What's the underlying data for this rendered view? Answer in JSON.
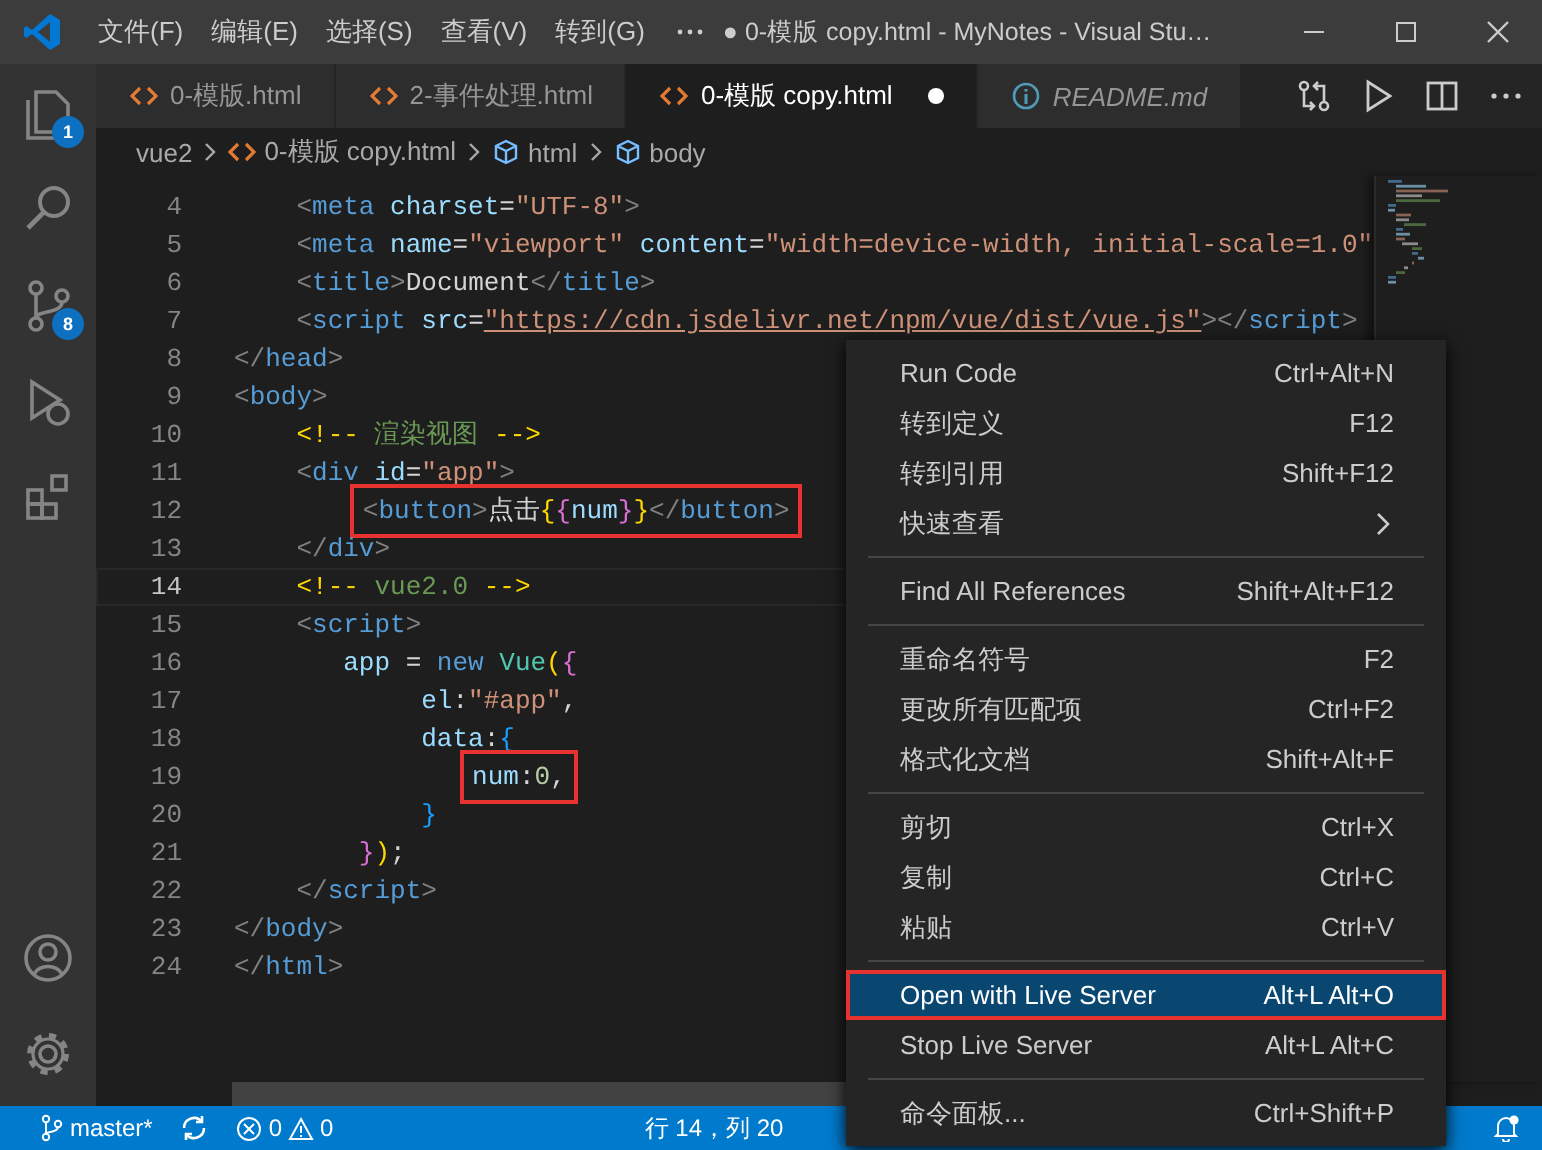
{
  "window": {
    "title": "● 0-模版 copy.html - MyNotes - Visual Stu…"
  },
  "menu_bar": [
    "文件(F)",
    "编辑(E)",
    "选择(S)",
    "查看(V)",
    "转到(G)"
  ],
  "activity_bar": {
    "top": [
      {
        "kind": "files",
        "badge": "1"
      },
      {
        "kind": "search"
      },
      {
        "kind": "scm",
        "badge": "8"
      },
      {
        "kind": "debug"
      },
      {
        "kind": "extensions"
      }
    ],
    "bottom": [
      {
        "kind": "account"
      },
      {
        "kind": "settings"
      }
    ]
  },
  "tabs": [
    {
      "label": "0-模版.html",
      "kind": "html",
      "selected": false,
      "modified": false,
      "preview": false
    },
    {
      "label": "2-事件处理.html",
      "kind": "html",
      "selected": false,
      "modified": false,
      "preview": false
    },
    {
      "label": "0-模版 copy.html",
      "kind": "html",
      "selected": true,
      "modified": true,
      "preview": false
    },
    {
      "label": "README.md",
      "kind": "info",
      "selected": false,
      "modified": false,
      "preview": true
    }
  ],
  "breadcrumb": [
    {
      "label": "vue2",
      "kind": "folder"
    },
    {
      "label": "0-模版 copy.html",
      "kind": "html"
    },
    {
      "label": "html",
      "kind": "element"
    },
    {
      "label": "body",
      "kind": "element"
    }
  ],
  "editor": {
    "lines": [
      {
        "number": "4",
        "tokens": [
          {
            "text": "    <",
            "kind": "p"
          },
          {
            "text": "meta",
            "kind": "tag"
          },
          {
            "text": " charset",
            "kind": "attr"
          },
          {
            "text": "=",
            "kind": "txt"
          },
          {
            "text": "\"UTF-8\"",
            "kind": "str"
          },
          {
            "text": ">",
            "kind": "p"
          }
        ]
      },
      {
        "number": "5",
        "tokens": [
          {
            "text": "    <",
            "kind": "p"
          },
          {
            "text": "meta",
            "kind": "tag"
          },
          {
            "text": " name",
            "kind": "attr"
          },
          {
            "text": "=",
            "kind": "txt"
          },
          {
            "text": "\"viewport\"",
            "kind": "str"
          },
          {
            "text": " content",
            "kind": "attr"
          },
          {
            "text": "=",
            "kind": "txt"
          },
          {
            "text": "\"width=device-width, initial-scale=1.0\"",
            "kind": "str"
          }
        ]
      },
      {
        "number": "6",
        "tokens": [
          {
            "text": "    <",
            "kind": "p"
          },
          {
            "text": "title",
            "kind": "tag"
          },
          {
            "text": ">",
            "kind": "p"
          },
          {
            "text": "Document",
            "kind": "txt"
          },
          {
            "text": "</",
            "kind": "p"
          },
          {
            "text": "title",
            "kind": "tag"
          },
          {
            "text": ">",
            "kind": "p"
          }
        ]
      },
      {
        "number": "7",
        "tokens": [
          {
            "text": "    <",
            "kind": "p"
          },
          {
            "text": "script",
            "kind": "tag"
          },
          {
            "text": " src",
            "kind": "attr"
          },
          {
            "text": "=",
            "kind": "txt"
          },
          {
            "text": "\"https://cdn.jsdelivr.net/npm/vue/dist/vue.js\"",
            "kind": "link"
          },
          {
            "text": ">",
            "kind": "p"
          },
          {
            "text": "</",
            "kind": "p"
          },
          {
            "text": "script",
            "kind": "tag"
          },
          {
            "text": ">",
            "kind": "p"
          }
        ]
      },
      {
        "number": "8",
        "tokens": [
          {
            "text": "</",
            "kind": "p"
          },
          {
            "text": "head",
            "kind": "tag"
          },
          {
            "text": ">",
            "kind": "p"
          }
        ]
      },
      {
        "number": "9",
        "tokens": [
          {
            "text": "<",
            "kind": "p"
          },
          {
            "text": "body",
            "kind": "tag"
          },
          {
            "text": ">",
            "kind": "p"
          }
        ]
      },
      {
        "number": "10",
        "tokens": [
          {
            "text": "    <!--",
            "kind": "y"
          },
          {
            "text": " 渲染视图 ",
            "kind": "cmt"
          },
          {
            "text": "-->",
            "kind": "y"
          }
        ]
      },
      {
        "number": "11",
        "tokens": [
          {
            "text": "    <",
            "kind": "p"
          },
          {
            "text": "div",
            "kind": "tag"
          },
          {
            "text": " id",
            "kind": "attr"
          },
          {
            "text": "=",
            "kind": "txt"
          },
          {
            "text": "\"app\"",
            "kind": "str"
          },
          {
            "text": ">",
            "kind": "p"
          }
        ]
      },
      {
        "number": "12",
        "annotated": true,
        "tokens": [
          {
            "text": "        <",
            "kind": "p"
          },
          {
            "text": "button",
            "kind": "tag"
          },
          {
            "text": ">",
            "kind": "p"
          },
          {
            "text": "点击",
            "kind": "txt"
          },
          {
            "text": "{",
            "kind": "y"
          },
          {
            "text": "{",
            "kind": "m"
          },
          {
            "text": "num",
            "kind": "var"
          },
          {
            "text": "}",
            "kind": "m"
          },
          {
            "text": "}",
            "kind": "y"
          },
          {
            "text": "</",
            "kind": "p"
          },
          {
            "text": "button",
            "kind": "tag"
          },
          {
            "text": ">",
            "kind": "p"
          }
        ]
      },
      {
        "number": "13",
        "tokens": [
          {
            "text": "    </",
            "kind": "p"
          },
          {
            "text": "div",
            "kind": "tag"
          },
          {
            "text": ">",
            "kind": "p"
          }
        ]
      },
      {
        "number": "14",
        "current": true,
        "tokens": [
          {
            "text": "    <!--",
            "kind": "y"
          },
          {
            "text": " vue2.0 ",
            "kind": "cmt"
          },
          {
            "text": "-->",
            "kind": "y"
          }
        ]
      },
      {
        "number": "15",
        "tokens": [
          {
            "text": "    <",
            "kind": "p"
          },
          {
            "text": "script",
            "kind": "tag"
          },
          {
            "text": ">",
            "kind": "p"
          }
        ]
      },
      {
        "number": "16",
        "tokens": [
          {
            "text": "       app",
            "kind": "var"
          },
          {
            "text": " = ",
            "kind": "txt"
          },
          {
            "text": "new ",
            "kind": "kw"
          },
          {
            "text": "Vue",
            "kind": "cls"
          },
          {
            "text": "(",
            "kind": "y"
          },
          {
            "text": "{",
            "kind": "m"
          }
        ]
      },
      {
        "number": "17",
        "tokens": [
          {
            "text": "            el",
            "kind": "var"
          },
          {
            "text": ":",
            "kind": "txt"
          },
          {
            "text": "\"#app\"",
            "kind": "str"
          },
          {
            "text": ",",
            "kind": "txt"
          }
        ]
      },
      {
        "number": "18",
        "tokens": [
          {
            "text": "            data",
            "kind": "var"
          },
          {
            "text": ":",
            "kind": "txt"
          },
          {
            "text": "{",
            "kind": "b"
          }
        ]
      },
      {
        "number": "19",
        "annotated": true,
        "tokens": [
          {
            "text": "               num",
            "kind": "var"
          },
          {
            "text": ":",
            "kind": "txt"
          },
          {
            "text": "0",
            "kind": "num"
          },
          {
            "text": ",",
            "kind": "txt"
          }
        ]
      },
      {
        "number": "20",
        "tokens": [
          {
            "text": "            }",
            "kind": "b"
          }
        ]
      },
      {
        "number": "21",
        "tokens": [
          {
            "text": "        }",
            "kind": "m"
          },
          {
            "text": ")",
            "kind": "y"
          },
          {
            "text": ";",
            "kind": "txt"
          }
        ]
      },
      {
        "number": "22",
        "tokens": [
          {
            "text": "    </",
            "kind": "p"
          },
          {
            "text": "script",
            "kind": "tag"
          },
          {
            "text": ">",
            "kind": "p"
          }
        ]
      },
      {
        "number": "23",
        "tokens": [
          {
            "text": "</",
            "kind": "p"
          },
          {
            "text": "body",
            "kind": "tag"
          },
          {
            "text": ">",
            "kind": "p"
          }
        ]
      },
      {
        "number": "24",
        "tokens": [
          {
            "text": "</",
            "kind": "p"
          },
          {
            "text": "html",
            "kind": "tag"
          },
          {
            "text": ">",
            "kind": "p"
          }
        ]
      }
    ]
  },
  "context_menu": {
    "groups": [
      [
        {
          "label": "Run Code",
          "shortcut": "Ctrl+Alt+N",
          "submenu": false,
          "selected": false,
          "annotated": false
        },
        {
          "label": "转到定义",
          "shortcut": "F12",
          "submenu": false,
          "selected": false,
          "annotated": false
        },
        {
          "label": "转到引用",
          "shortcut": "Shift+F12",
          "submenu": false,
          "selected": false,
          "annotated": false
        },
        {
          "label": "快速查看",
          "submenu": true,
          "selected": false,
          "annotated": false
        }
      ],
      [
        {
          "label": "Find All References",
          "shortcut": "Shift+Alt+F12",
          "submenu": false,
          "selected": false,
          "annotated": false
        }
      ],
      [
        {
          "label": "重命名符号",
          "shortcut": "F2",
          "submenu": false,
          "selected": false,
          "annotated": false
        },
        {
          "label": "更改所有匹配项",
          "shortcut": "Ctrl+F2",
          "submenu": false,
          "selected": false,
          "annotated": false
        },
        {
          "label": "格式化文档",
          "shortcut": "Shift+Alt+F",
          "submenu": false,
          "selected": false,
          "annotated": false
        }
      ],
      [
        {
          "label": "剪切",
          "shortcut": "Ctrl+X",
          "submenu": false,
          "selected": false,
          "annotated": false
        },
        {
          "label": "复制",
          "shortcut": "Ctrl+C",
          "submenu": false,
          "selected": false,
          "annotated": false
        },
        {
          "label": "粘贴",
          "shortcut": "Ctrl+V",
          "submenu": false,
          "selected": false,
          "annotated": false
        }
      ],
      [
        {
          "label": "Open with Live Server",
          "shortcut": "Alt+L Alt+O",
          "submenu": false,
          "selected": true,
          "annotated": true
        },
        {
          "label": "Stop Live Server",
          "shortcut": "Alt+L Alt+C",
          "submenu": false,
          "selected": false,
          "annotated": false
        }
      ],
      [
        {
          "label": "命令面板...",
          "shortcut": "Ctrl+Shift+P",
          "submenu": false,
          "selected": false,
          "annotated": false
        }
      ]
    ]
  },
  "status_bar": {
    "branch": "master*",
    "errors": "0",
    "warnings": "0",
    "position": "行 14，列 20"
  }
}
